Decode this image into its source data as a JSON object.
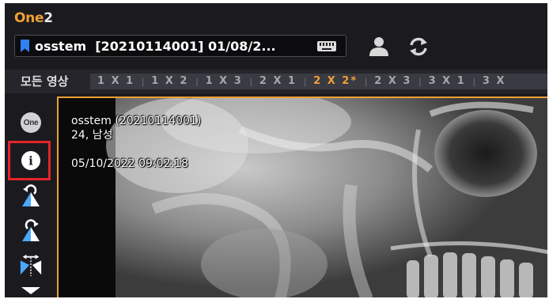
{
  "app": {
    "brand_part1": "One",
    "brand_part2": "2"
  },
  "header": {
    "patient_label": "osstem  [20210114001] 01/08/2...",
    "icons": [
      "bookmark-icon",
      "keyboard-icon",
      "user-icon",
      "refresh-icon"
    ]
  },
  "layout_bar": {
    "all_images_label": "모든 영상",
    "tabs": [
      {
        "label": "1 X 1",
        "active": false
      },
      {
        "label": "1 X 2",
        "active": false
      },
      {
        "label": "1 X 3",
        "active": false
      },
      {
        "label": "2 X 1",
        "active": false
      },
      {
        "label": "2 X 2*",
        "active": true
      },
      {
        "label": "2 X 3",
        "active": false
      },
      {
        "label": "3 X 1",
        "active": false
      },
      {
        "label": "3 X",
        "active": false
      }
    ]
  },
  "toolbar": {
    "one_label": "One",
    "info_label": "i",
    "tools": [
      "one-icon",
      "info-icon",
      "rotate-left-icon",
      "rotate-right-icon",
      "flip-horizontal-icon",
      "flip-vertical-icon"
    ]
  },
  "viewer": {
    "patient_line": "osstem (20210114001)",
    "age_sex_line": "24, 남성",
    "datetime_line": "05/10/2022 09:02:18"
  },
  "colors": {
    "accent": "#f0a035",
    "highlight": "#e4252b",
    "bookmark": "#2f7ff2",
    "background": "#1b1b1f"
  }
}
